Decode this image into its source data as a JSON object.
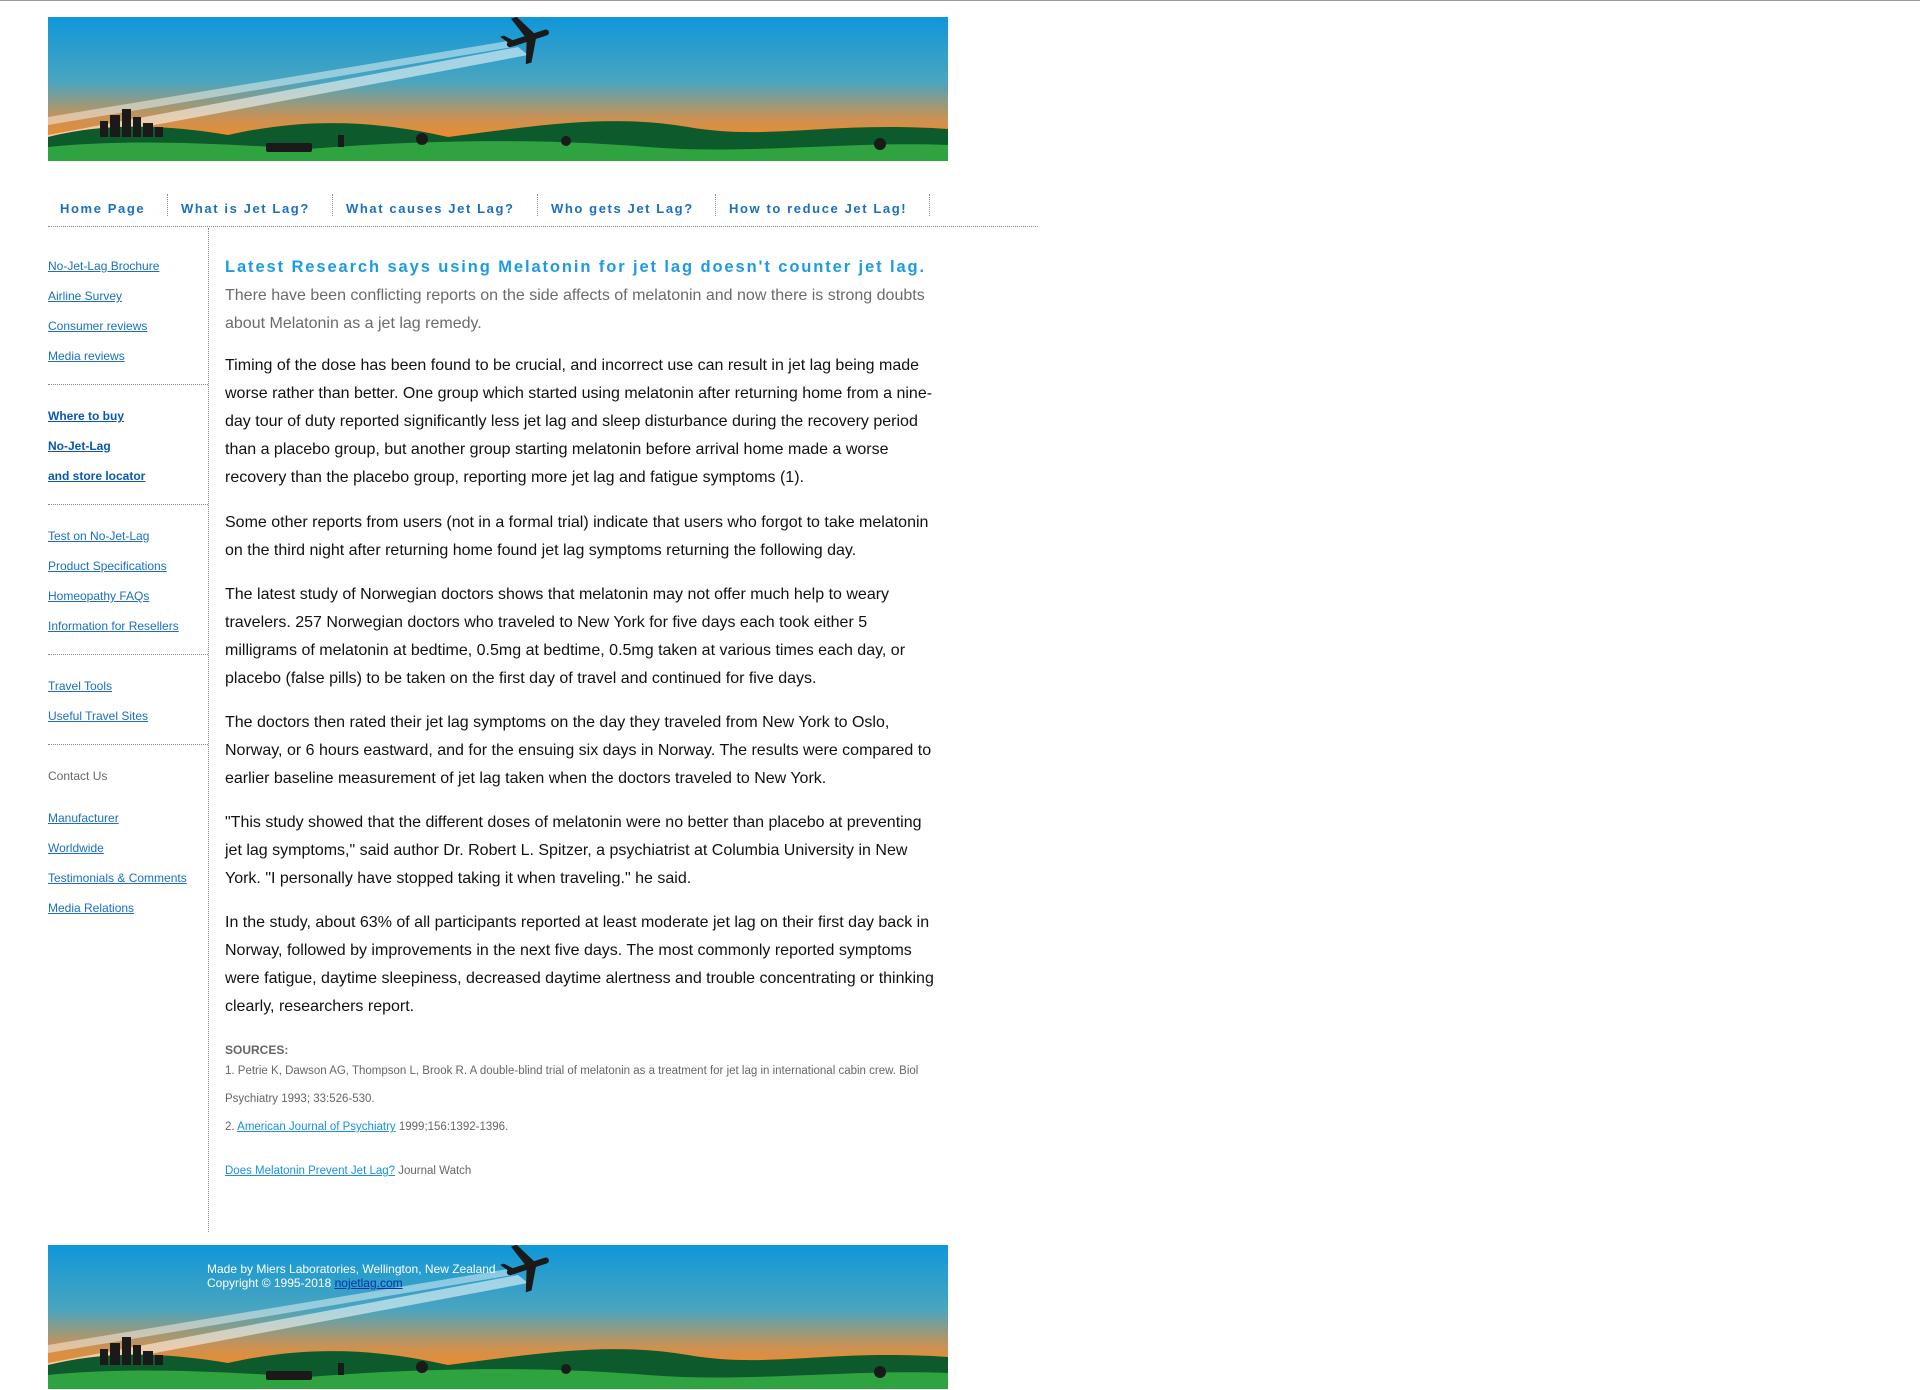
{
  "nav": {
    "items": [
      {
        "label": "Home Page"
      },
      {
        "label": "What is Jet Lag?"
      },
      {
        "label": "What causes Jet Lag?"
      },
      {
        "label": "Who gets Jet Lag?"
      },
      {
        "label": "How to reduce Jet Lag!"
      }
    ]
  },
  "sidebar": {
    "group1": [
      "No-Jet-Lag Brochure",
      "Airline Survey",
      "Consumer reviews",
      "Media reviews"
    ],
    "group2": [
      "Where to buy",
      "No-Jet-Lag",
      "and store locator"
    ],
    "group3": [
      "Test on No-Jet-Lag",
      "Product Specifications",
      "Homeopathy FAQs",
      "Information for Resellers"
    ],
    "group4": [
      "Travel Tools",
      "Useful Travel Sites"
    ],
    "contact": "Contact Us",
    "group5": [
      "Manufacturer",
      "Worldwide",
      "Testimonials & Comments",
      "Media Relations"
    ]
  },
  "article": {
    "headline": "Latest Research says using Melatonin for jet lag doesn't counter jet lag.",
    "intro": "There have been conflicting reports on the side affects of melatonin and now there is strong doubts about Melatonin as a jet lag remedy.",
    "paragraphs": [
      "Timing of the dose has been found to be crucial, and incorrect use can result in jet lag being made worse rather than better. One group which started using melatonin after returning home from a nine-day tour of duty reported significantly less jet lag and sleep disturbance during the recovery period than a placebo group, but another group starting melatonin before arrival home made a worse recovery than the placebo group, reporting more jet lag and fatigue symptoms (1).",
      "Some other reports from users (not in a formal trial) indicate that users who forgot to take melatonin on the third night after returning home found jet lag symptoms returning the following day.",
      "The latest study of Norwegian doctors shows that melatonin may not offer much help to weary travelers. 257 Norwegian doctors who traveled to New York for five days each took either 5 milligrams of melatonin at bedtime, 0.5mg at bedtime, 0.5mg taken at various times each day, or placebo (false pills) to be taken on the first day of travel and continued for five days.",
      "The doctors then rated their jet lag symptoms on the day they traveled from New York to Oslo, Norway, or 6 hours eastward, and for the ensuing six days in Norway. The results were compared to earlier baseline measurement of jet lag taken when the doctors traveled to New York.",
      "\"This study showed that the different doses of melatonin were no better than placebo at preventing jet lag symptoms,\" said author Dr. Robert L. Spitzer, a psychiatrist at Columbia University in New York. \"I personally have stopped taking it when traveling.\" he said.",
      "In the study, about 63% of all participants reported at least moderate jet lag on their first day back in Norway, followed by improvements in the next five days. The most commonly reported symptoms were fatigue, daytime sleepiness, decreased daytime alertness and trouble concentrating or thinking clearly, researchers report."
    ],
    "sources_label": "SOURCES:",
    "source1": "1. Petrie K, Dawson AG, Thompson L, Brook R. A double-blind trial of melatonin as a treatment for jet lag in international cabin crew. Biol Psychiatry 1993; 33:526-530.",
    "source2_prefix": "2. ",
    "source2_link": "American Journal of Psychiatry",
    "source2_suffix": " 1999;156:1392-1396.",
    "extra_link": "Does Melatonin Prevent Jet Lag?",
    "extra_suffix": " Journal Watch"
  },
  "footer": {
    "line1": "Made by Miers Laboratories, Wellington, New Zealand",
    "line2_prefix": "Copyright © 1995-2018 ",
    "line2_link": "nojetlag.com"
  }
}
